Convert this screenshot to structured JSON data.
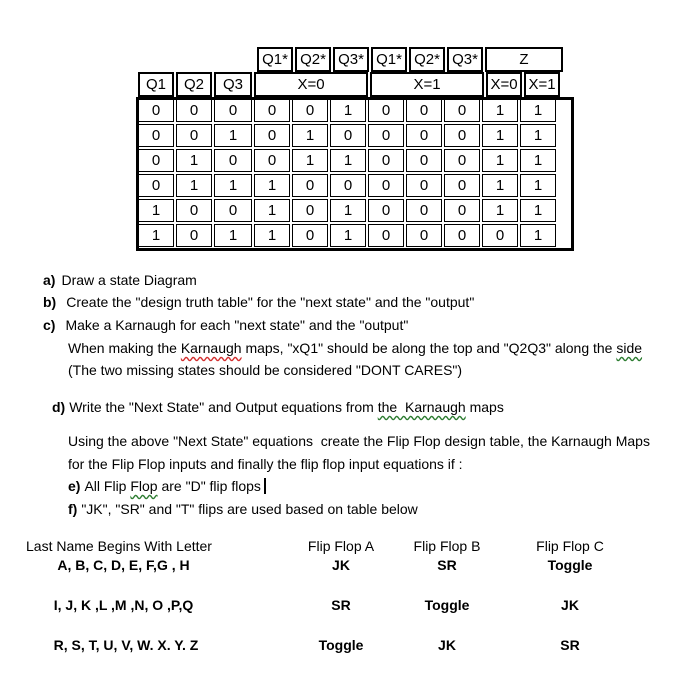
{
  "table": {
    "top_headers": [
      "Q1*",
      "Q2*",
      "Q3*",
      "Q1*",
      "Q2*",
      "Q3*",
      "Z"
    ],
    "mid_headers": {
      "state": [
        "Q1",
        "Q2",
        "Q3"
      ],
      "x0": "X=0",
      "x1": "X=1",
      "z": [
        "X=0",
        "X=1"
      ]
    },
    "rows": [
      [
        "0",
        "0",
        "0",
        "0",
        "0",
        "1",
        "0",
        "0",
        "0",
        "1",
        "1"
      ],
      [
        "0",
        "0",
        "1",
        "0",
        "1",
        "0",
        "0",
        "0",
        "0",
        "1",
        "1"
      ],
      [
        "0",
        "1",
        "0",
        "0",
        "1",
        "1",
        "0",
        "0",
        "0",
        "1",
        "1"
      ],
      [
        "0",
        "1",
        "1",
        "1",
        "0",
        "0",
        "0",
        "0",
        "0",
        "1",
        "1"
      ],
      [
        "1",
        "0",
        "0",
        "1",
        "0",
        "1",
        "0",
        "0",
        "0",
        "1",
        "1"
      ],
      [
        "1",
        "0",
        "1",
        "1",
        "0",
        "1",
        "0",
        "0",
        "0",
        "0",
        "1"
      ]
    ]
  },
  "instructions": {
    "a": {
      "label": "a)",
      "text": "Draw a state Diagram"
    },
    "b": {
      "label": "b)",
      "text": "Create the \"design truth table\" for the \"next state\" and the \"output\""
    },
    "c": {
      "label": "c)",
      "text": "Make a Karnaugh for each \"next state\" and the \"output\""
    },
    "c_line2_pre": "When making the ",
    "c_line2_word": "Karnaugh",
    "c_line2_mid": " maps, \"xQ1\" should be along the top and \"Q2Q3\" along the ",
    "c_line2_end": "side",
    "c_line3": "(The two missing states should be considered \"DONT CARES\")",
    "d": {
      "label": "d)",
      "text_pre": "Write the \"Next State\" and Output equations from ",
      "text_sq": "the  Karnaugh",
      "text_post": " maps"
    },
    "para1": "Using the above \"Next State\" equations  create the Flip Flop design table, the Karnaugh Maps",
    "para2": "for the Flip Flop inputs and finally the flip flop input equations if :",
    "e": {
      "label": "e)",
      "text_pre": "All Flip ",
      "text_sq": "Flop",
      "text_post": " are \"D\" flip flops"
    },
    "f": {
      "label": "f)",
      "text": "\"JK\", \"SR\" and \"T\" flips are used based on table below"
    }
  },
  "lookup": {
    "headers": [
      "Last Name Begins With Letter",
      "Flip Flop A",
      "Flip Flop B",
      "Flip Flop C"
    ],
    "rows": [
      [
        "A, B, C, D, E, F,G , H",
        "JK",
        "SR",
        "Toggle"
      ],
      [
        "I, J, K ,L ,M ,N, O ,P,Q",
        "SR",
        "Toggle",
        "JK"
      ],
      [
        "R, S, T, U, V, W. X. Y. Z",
        "Toggle",
        "JK",
        "SR"
      ]
    ]
  }
}
